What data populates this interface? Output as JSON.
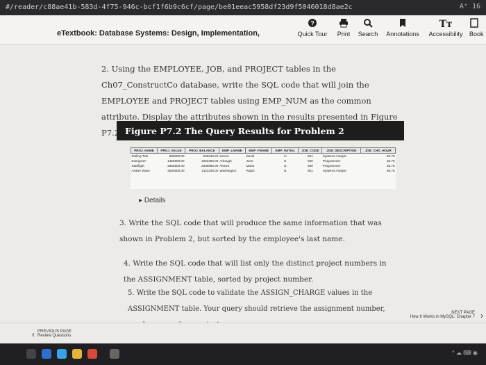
{
  "browser": {
    "url": "#/reader/c88ae41b-583d-4f75-946c-bcf1f6b9c6cf/page/be01eeac5958df23d9f5046018d8ae2c",
    "tray": "A⁺  16"
  },
  "toolbar": {
    "book_title": "eTextbook: Database Systems: Design, Implementation,",
    "items": [
      {
        "label": "Quick Tour",
        "icon": "question-circle-icon"
      },
      {
        "label": "Print",
        "icon": "printer-icon"
      },
      {
        "label": "Search",
        "icon": "search-icon"
      },
      {
        "label": "Annotations",
        "icon": "bookmark-icon"
      },
      {
        "label": "Accessibility",
        "icon": "text-size-icon"
      },
      {
        "label": "Book",
        "icon": "book-icon"
      }
    ]
  },
  "content": {
    "q2": "2. Using the EMPLOYEE, JOB, and PROJECT tables in the Ch07_ConstructCo database, write the SQL code that will join the EMPLOYEE and PROJECT tables using EMP_NUM as the common attribute. Display the attributes shown in the results presented in Figure P7.2, sorted by project value.",
    "figure_title": "Figure P7.2  The Query Results for Problem 2",
    "figure_table": {
      "headers": [
        "PROJ_NAME",
        "PROJ_VALUE",
        "PROJ_BALANCE",
        "EMP_LNAME",
        "EMP_FNAME",
        "EMP_INITIAL",
        "JOB_CODE",
        "JOB_DESCRIPTION",
        "JOB_CHG_HOUR"
      ],
      "rows": [
        [
          "Rolling Tide",
          "805000.00",
          "500345.20",
          "Senior",
          "David",
          "H",
          "501",
          "Systems Analyst",
          "96.75"
        ],
        [
          "Evergreen",
          "1453500.00",
          "1002350.00",
          "Arbough",
          "June",
          "E",
          "500",
          "Programmer",
          "35.75"
        ],
        [
          "Starflight",
          "2650500.00",
          "2309880.00",
          "Alonzo",
          "Maria",
          "D",
          "500",
          "Programmer",
          "35.75"
        ],
        [
          "Amber Wave",
          "3500500.00",
          "2110346.00",
          "Washington",
          "Ralph",
          "B",
          "501",
          "Systems Analyst",
          "96.75"
        ]
      ]
    },
    "details_label": "Details",
    "q3": "3. Write the SQL code that will produce the same information that was shown in Problem 2, but sorted by the employee's last name.",
    "q4": "4. Write the SQL code that will list only the distinct project numbers in the ASSIGNMENT table, sorted by project number.",
    "q5": "5. Write the SQL code to validate the ASSIGN_CHARGE values in the ASSIGNMENT table. Your query should retrieve the assignment number, employee number, project"
  },
  "footer": {
    "prev_label": "PREVIOUS PAGE",
    "prev_sub": "Review Questions",
    "next_label": "NEXT PAGE",
    "next_sub": "How It Works in MySQL: Chapter 7"
  }
}
